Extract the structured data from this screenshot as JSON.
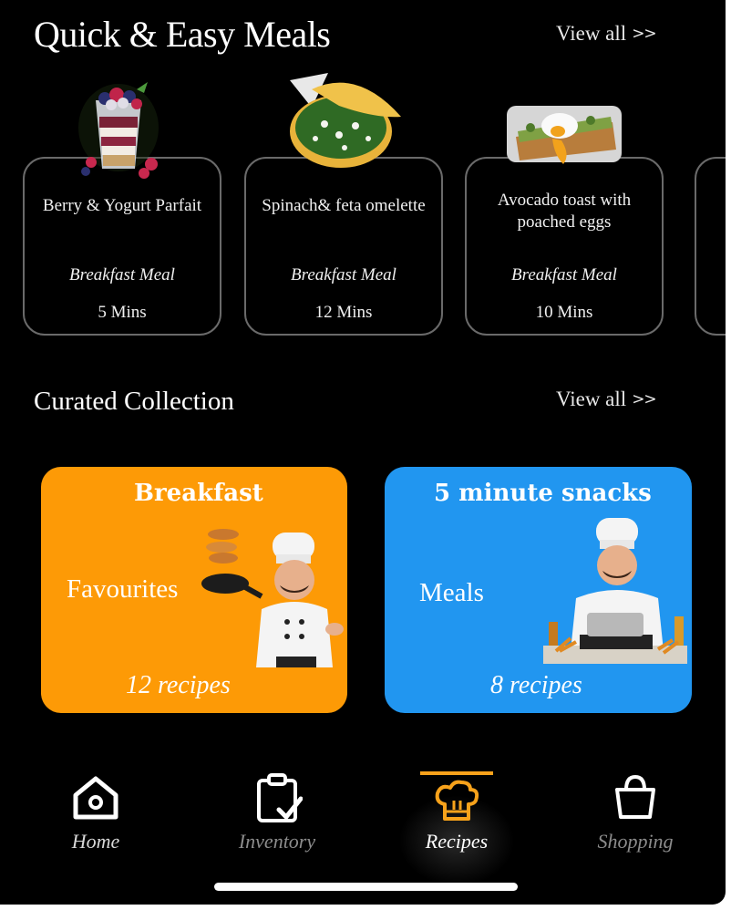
{
  "quick": {
    "title": "Quick & Easy Meals",
    "view_all": "View all",
    "meals": [
      {
        "name": "Berry & Yogurt Parfait",
        "type": "Breakfast Meal",
        "time": "5 Mins"
      },
      {
        "name": "Spinach& feta omelette",
        "type": "Breakfast Meal",
        "time": "12 Mins"
      },
      {
        "name": "Avocado toast with poached eggs",
        "type": "Breakfast Meal",
        "time": "10 Mins"
      }
    ]
  },
  "curated": {
    "title": "Curated Collection",
    "view_all": "View all",
    "collections": [
      {
        "title": "Breakfast",
        "subtitle": "Favourites",
        "count": "12 recipes",
        "color": "#fd9a06"
      },
      {
        "title": "5 minute snacks",
        "subtitle": "Meals",
        "count": "8 recipes",
        "color": "#2196f0"
      }
    ]
  },
  "tabs": [
    {
      "label": "Home",
      "icon": "home-icon",
      "active": false
    },
    {
      "label": "Inventory",
      "icon": "clipboard-check-icon",
      "active": false
    },
    {
      "label": "Recipes",
      "icon": "chef-hat-icon",
      "active": true
    },
    {
      "label": "Shopping",
      "icon": "shopping-bag-icon",
      "active": false
    }
  ],
  "colors": {
    "accent": "#f7a21b",
    "background": "#000000"
  }
}
